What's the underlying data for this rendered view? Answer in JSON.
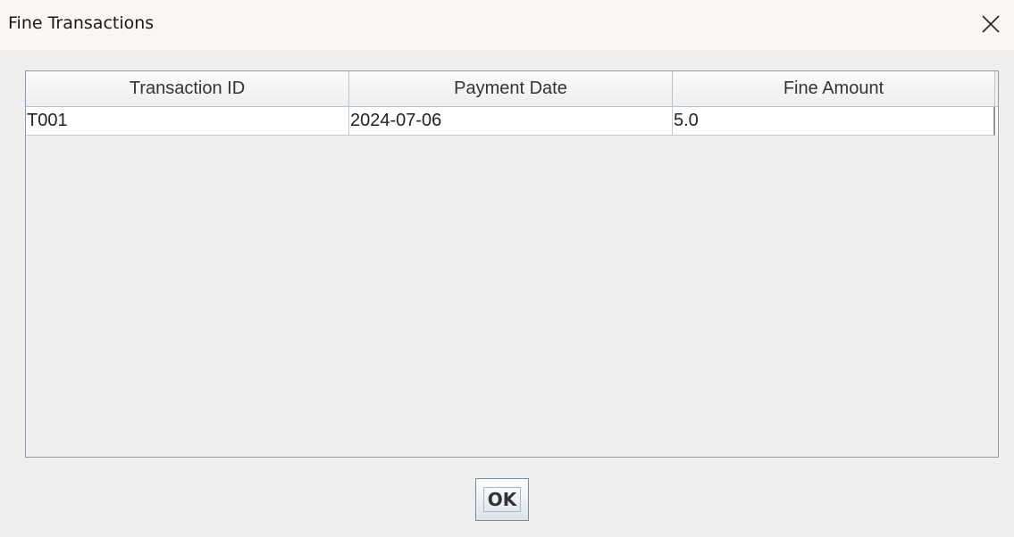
{
  "window": {
    "title": "Fine Transactions"
  },
  "icons": {
    "close": "close-icon"
  },
  "table": {
    "columns": [
      "Transaction ID",
      "Payment Date",
      "Fine Amount"
    ],
    "rows": [
      [
        "T001",
        "2024-07-06",
        "5.0"
      ]
    ]
  },
  "buttons": {
    "ok_label": "OK"
  },
  "colors": {
    "title_bar": "#f9f6f3",
    "dialog_background": "#eeeeee",
    "table_border": "#8e9aa6"
  }
}
